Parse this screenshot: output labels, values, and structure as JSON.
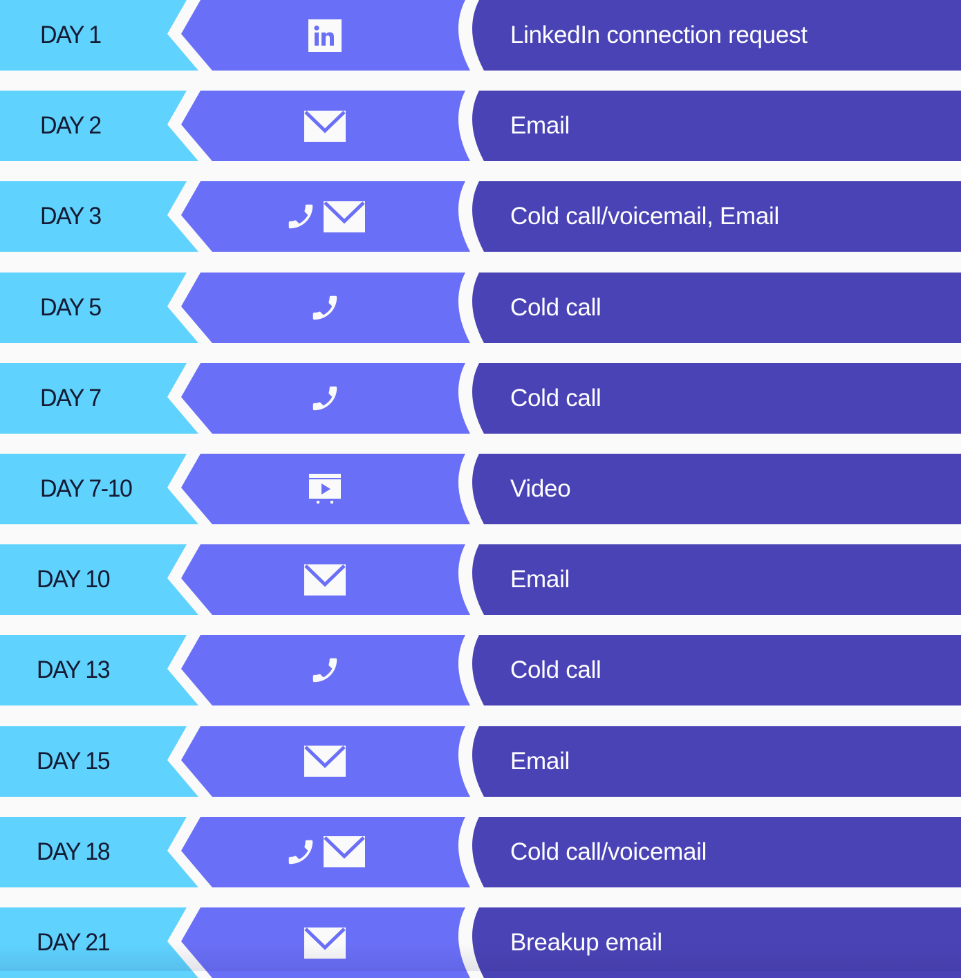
{
  "colors": {
    "day_band": "#5fd3fe",
    "channel_band": "#6a6ff7",
    "action_band": "#4a43b5",
    "background": "#fafafa",
    "day_text": "#151a33",
    "icon": "#fafafa"
  },
  "steps": [
    {
      "day": "DAY 1",
      "icons": [
        "linkedin-icon"
      ],
      "action": "LinkedIn connection request"
    },
    {
      "day": "DAY 2",
      "icons": [
        "email-icon"
      ],
      "action": "Email"
    },
    {
      "day": "DAY 3",
      "icons": [
        "phone-icon",
        "email-icon"
      ],
      "action": "Cold call/voicemail, Email"
    },
    {
      "day": "DAY 5",
      "icons": [
        "phone-icon"
      ],
      "action": "Cold call"
    },
    {
      "day": "DAY 7",
      "icons": [
        "phone-icon"
      ],
      "action": "Cold call"
    },
    {
      "day": "DAY 7-10",
      "icons": [
        "video-icon"
      ],
      "action": "Video"
    },
    {
      "day": "DAY 10",
      "icons": [
        "email-icon"
      ],
      "action": "Email"
    },
    {
      "day": "DAY 13",
      "icons": [
        "phone-icon"
      ],
      "action": "Cold call"
    },
    {
      "day": "DAY 15",
      "icons": [
        "email-icon"
      ],
      "action": "Email"
    },
    {
      "day": "DAY 18",
      "icons": [
        "phone-icon",
        "email-icon"
      ],
      "action": "Cold call/voicemail"
    },
    {
      "day": "DAY 21",
      "icons": [
        "email-icon"
      ],
      "action": "Breakup email"
    }
  ]
}
